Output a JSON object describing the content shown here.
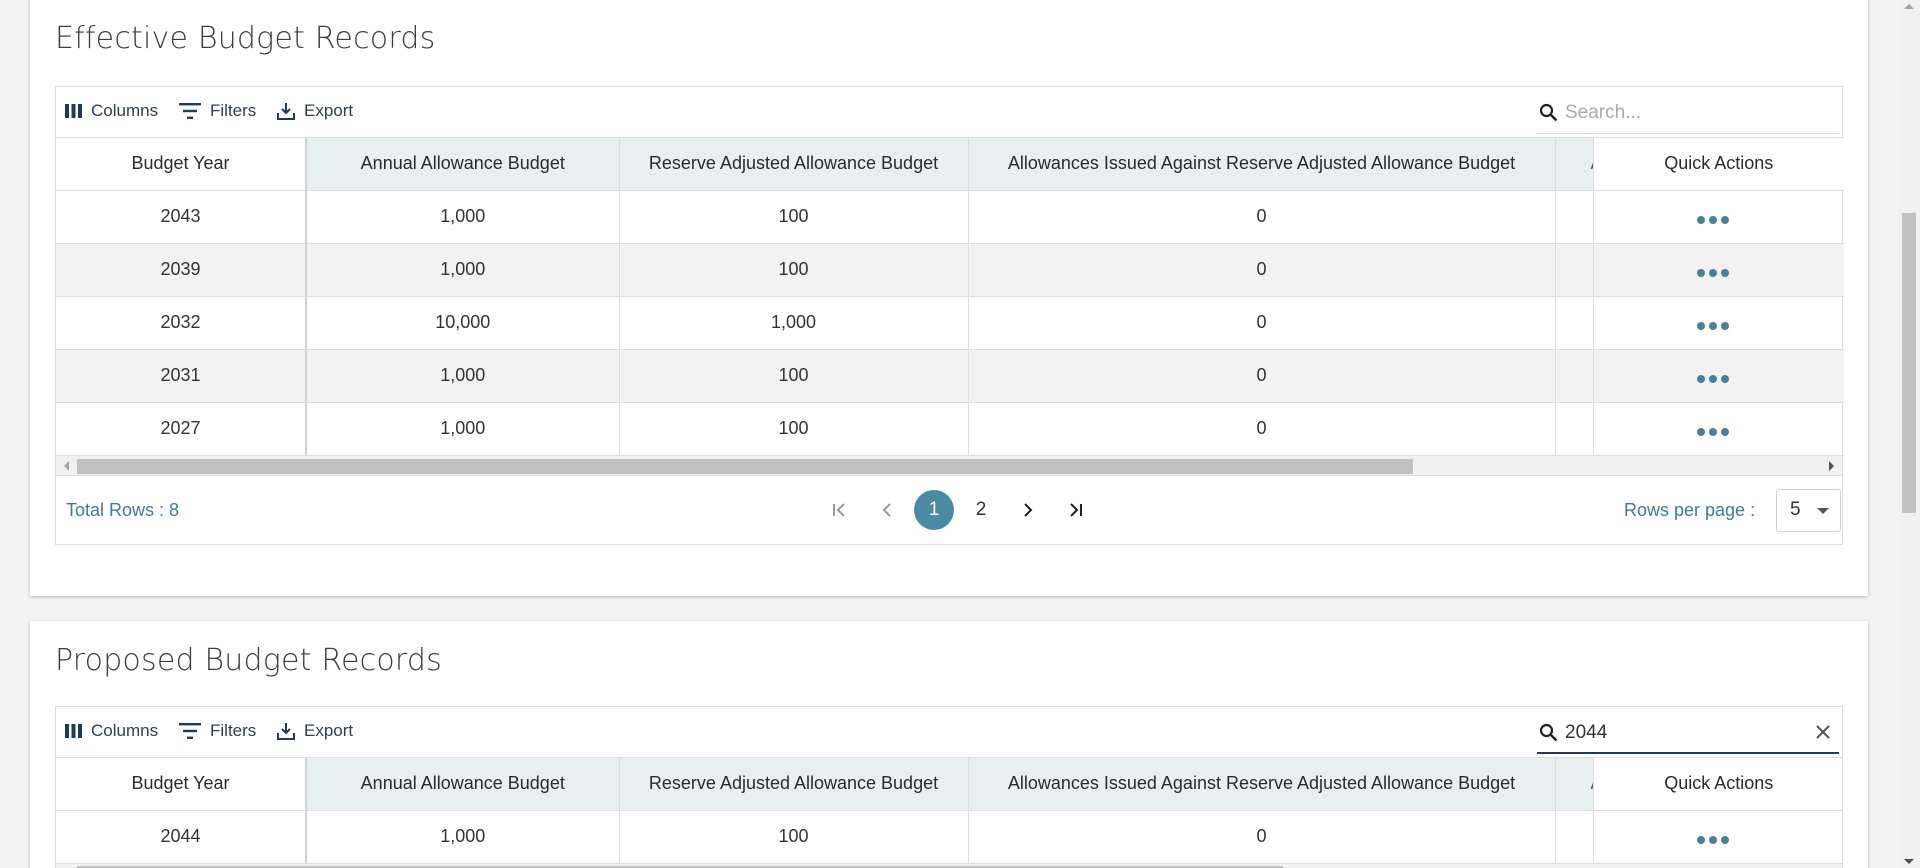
{
  "colors": {
    "accent": "#4a8aa2",
    "link_text": "#3d7c96",
    "header_bg": "#e7eff1",
    "dots": "#4a7f9a"
  },
  "effective": {
    "title": "Effective Budget Records",
    "toolbar": {
      "columns": "Columns",
      "filters": "Filters",
      "export": "Export"
    },
    "search": {
      "placeholder": "Search...",
      "value": ""
    },
    "columns": [
      "Budget Year",
      "Annual Allowance Budget",
      "Reserve Adjusted Allowance Budget",
      "Allowances Issued Against Reserve Adjusted Allowance Budget",
      "A",
      "Quick Actions"
    ],
    "rows": [
      {
        "year": "2043",
        "annual": "1,000",
        "reserve": "100",
        "issued": "0"
      },
      {
        "year": "2039",
        "annual": "1,000",
        "reserve": "100",
        "issued": "0"
      },
      {
        "year": "2032",
        "annual": "10,000",
        "reserve": "1,000",
        "issued": "0"
      },
      {
        "year": "2031",
        "annual": "1,000",
        "reserve": "100",
        "issued": "0"
      },
      {
        "year": "2027",
        "annual": "1,000",
        "reserve": "100",
        "issued": "0"
      }
    ],
    "footer": {
      "total_rows": "Total Rows : 8",
      "pages": [
        "1",
        "2"
      ],
      "current_page": "1",
      "rows_per_page_label": "Rows per page :",
      "rows_per_page_value": "5"
    }
  },
  "proposed": {
    "title": "Proposed Budget Records",
    "toolbar": {
      "columns": "Columns",
      "filters": "Filters",
      "export": "Export"
    },
    "search": {
      "placeholder": "Search...",
      "value": "2044"
    },
    "columns": [
      "Budget Year",
      "Annual Allowance Budget",
      "Reserve Adjusted Allowance Budget",
      "Allowances Issued Against Reserve Adjusted Allowance Budget",
      "A",
      "Quick Actions"
    ],
    "rows": [
      {
        "year": "2044",
        "annual": "1,000",
        "reserve": "100",
        "issued": "0"
      }
    ]
  },
  "icons": [
    "columns-icon",
    "filter-icon",
    "export-icon",
    "search-icon",
    "clear-icon",
    "more-dots-icon",
    "first-page-icon",
    "prev-page-icon",
    "next-page-icon",
    "last-page-icon",
    "dropdown-caret-icon"
  ]
}
